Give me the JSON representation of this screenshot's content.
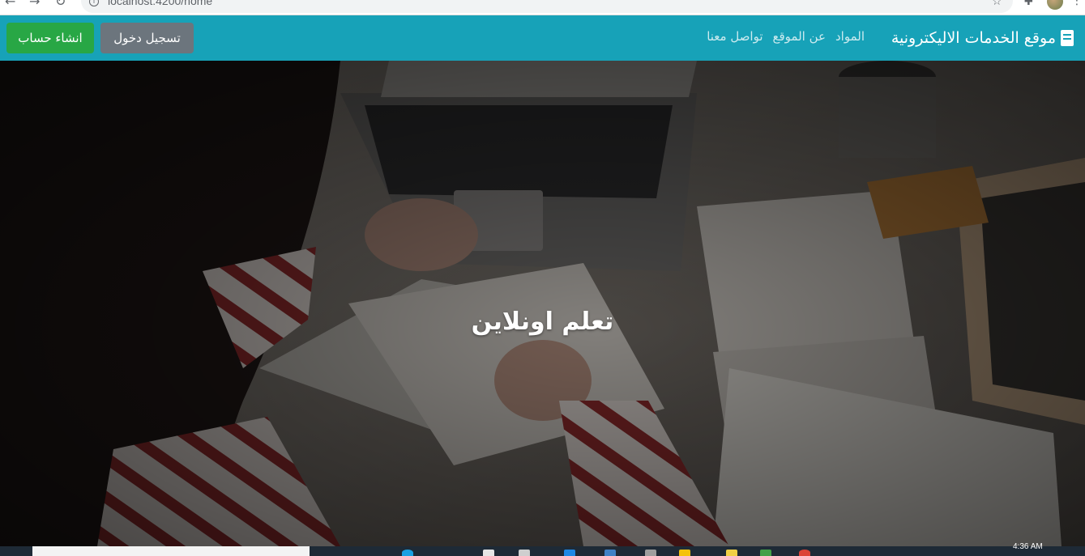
{
  "browser": {
    "url": "localhost:4200/home",
    "back_icon": "arrow-left-icon",
    "forward_icon": "arrow-right-icon",
    "reload_icon": "reload-icon"
  },
  "navbar": {
    "brand": "موقع الخدمات الاليكترونية",
    "brand_icon": "book-icon",
    "links": [
      "المواد",
      "عن الموقع",
      "تواصل معنا"
    ],
    "login_label": "تسجيل دخول",
    "signup_label": "انشاء حساب",
    "colors": {
      "navbar_bg": "#17a2b8",
      "login_bg": "#6c757d",
      "signup_bg": "#28a745"
    }
  },
  "hero": {
    "title": "تعلم اونلاين",
    "background": "photo of student writing in notebook at laptop desk"
  },
  "taskbar": {
    "time": "4:36 AM"
  }
}
